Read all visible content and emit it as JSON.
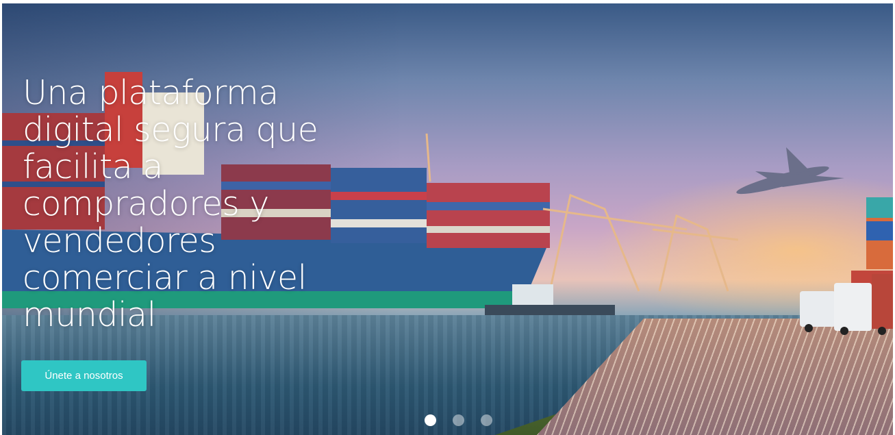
{
  "hero": {
    "headline": "Una plataforma digital segura que facilita a compradores y vendedores comerciar a nivel mundial",
    "cta_label": "Únete a nosotros",
    "accent_color": "#2fc6c4",
    "background_image": "cargo-ship-port-plane-trucks-sunset"
  },
  "carousel": {
    "slide_count": 3,
    "active_index": 0
  }
}
